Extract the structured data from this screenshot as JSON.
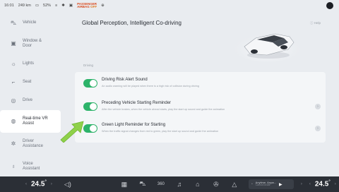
{
  "status": {
    "time": "16:01",
    "range": "249 km",
    "battery": "52%",
    "airbag_line1": "PASSENGER",
    "airbag_line2": "AIRBAG",
    "airbag_state": "OFF"
  },
  "sidebar": {
    "items": [
      {
        "label": "Vehicle",
        "icon": "car-icon",
        "glyph": "⛍"
      },
      {
        "label": "Window & Door",
        "icon": "window-icon",
        "glyph": "▣"
      },
      {
        "label": "Lights",
        "icon": "light-icon",
        "glyph": "☼"
      },
      {
        "label": "Seat",
        "icon": "seat-icon",
        "glyph": "⌐"
      },
      {
        "label": "Drive",
        "icon": "steering-icon",
        "glyph": "◎"
      },
      {
        "label": "Real-time VR Assist",
        "icon": "vr-assist-icon",
        "glyph": "◍"
      },
      {
        "label": "Driver Assistance",
        "icon": "driver-assist-icon",
        "glyph": "✲"
      },
      {
        "label": "Voice Assistant",
        "icon": "voice-icon",
        "glyph": "♁"
      }
    ],
    "active_index": 5
  },
  "main": {
    "title": "Global Perception, Intelligent Co-driving",
    "help": "Help",
    "section_label": "Driving",
    "settings": [
      {
        "title": "Driving Risk Alert Sound",
        "desc": "An audio warning will be played when there is a high risk of collision during driving",
        "enabled": true
      },
      {
        "title": "Preceding Vehicle Starting Reminder",
        "desc": "After the vehicle brakes, when the vehicle ahead starts, play the start up sound and guide the animation",
        "enabled": true
      },
      {
        "title": "Green Light Reminder for Starting",
        "desc": "When the traffic signal changes from red to green, play the start up sound and guide the animation",
        "enabled": true
      }
    ]
  },
  "bottom": {
    "left_temp": "24.5",
    "right_temp": "24.5",
    "deg": "°",
    "music_title": "Anytime, Anyw...",
    "music_sub": "Cannot locate",
    "icon_360": "360"
  },
  "colors": {
    "toggle_on": "#2db36a",
    "arrow": "#8fd14a",
    "bottom_bar": "#2b2f36"
  }
}
